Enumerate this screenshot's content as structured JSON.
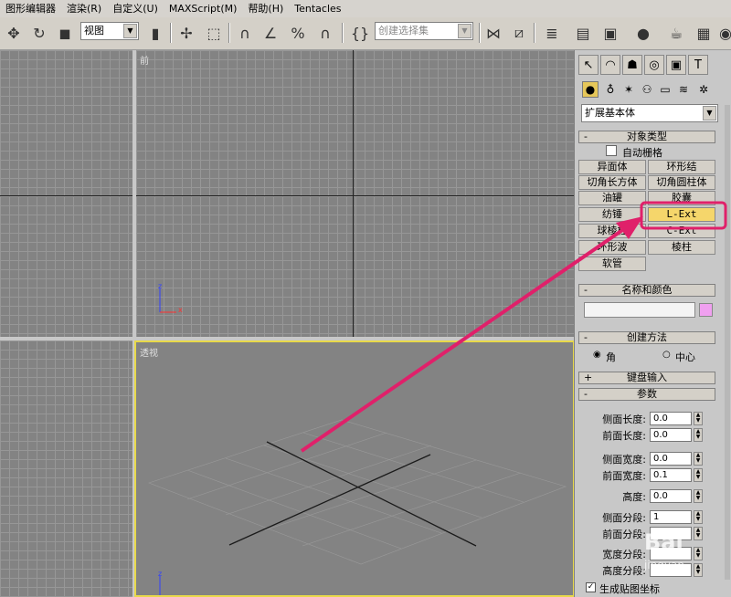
{
  "menu": [
    "图形编辑器",
    "渲染(R)",
    "自定义(U)",
    "MAXScript(M)",
    "帮助(H)",
    "Tentacles"
  ],
  "toolbar": {
    "view_select": "视图",
    "selection_set_placeholder": "创建选择集"
  },
  "viewports": {
    "front_label": "前",
    "persp_label": "透视"
  },
  "panel": {
    "category_select": "扩展基本体",
    "object_type_title": "对象类型",
    "auto_grid_label": "自动栅格",
    "buttons": [
      [
        "异面体",
        "环形结"
      ],
      [
        "切角长方体",
        "切角圆柱体"
      ],
      [
        "油罐",
        "胶囊"
      ],
      [
        "纺锤",
        "L-Ext"
      ],
      [
        "球棱柱",
        "C-Ext"
      ],
      [
        "环形波",
        "棱柱"
      ],
      [
        "软管",
        ""
      ]
    ],
    "name_color_title": "名称和颜色",
    "name_value": "",
    "object_color": "#f0a0f0",
    "creation_method_title": "创建方法",
    "creation_options": [
      "角",
      "中心"
    ],
    "keyboard_entry_title": "键盘输入",
    "params_title": "参数",
    "params": [
      {
        "label": "侧面长度:",
        "value": "0.0"
      },
      {
        "label": "前面长度:",
        "value": "0.0"
      },
      {
        "label": "侧面宽度:",
        "value": "0.0"
      },
      {
        "label": "前面宽度:",
        "value": "0.1"
      },
      {
        "label": "高度:",
        "value": "0.0"
      },
      {
        "label": "侧面分段:",
        "value": "1"
      },
      {
        "label": "前面分段:",
        "value": ""
      },
      {
        "label": "宽度分段:",
        "value": ""
      },
      {
        "label": "高度分段:",
        "value": ""
      }
    ],
    "gen_mapping_label": "生成贴图坐标"
  },
  "watermark": {
    "brand": "Bai",
    "sub": "jingyan"
  },
  "colors": {
    "highlight": "#e0206a",
    "active_viewport": "#e8d94a",
    "active_button": "#f5d66b"
  }
}
